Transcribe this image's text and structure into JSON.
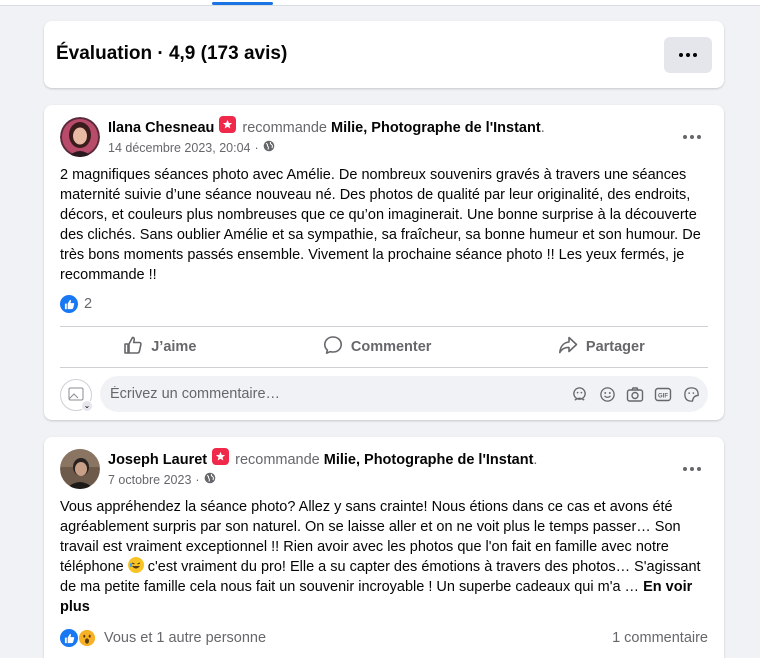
{
  "header": {
    "title": "Évaluation · 4,9 (173 avis)"
  },
  "posts": [
    {
      "author": "Ilana Chesneau",
      "recommends": "recommande",
      "page": "Milie, Photographe de l'Instant",
      "date": "14 décembre 2023, 20:04",
      "text": "2 magnifiques séances photo avec Amélie. De nombreux souvenirs gravés à travers une séances maternité suivie d’une séance nouveau né. Des photos de qualité par leur originalité, des endroits, décors, et couleurs plus nombreuses que ce qu’on imaginerait. Une bonne surprise à la découverte des clichés. Sans oublier Amélie et sa sympathie, sa fraîcheur, sa bonne humeur et son humour. De très bons moments passés ensemble. Vivement la prochaine séance photo !! Les yeux fermés, je recommande !!",
      "reaction_count": "2",
      "actions": {
        "like": "J’aime",
        "comment": "Commenter",
        "share": "Partager"
      },
      "comment_placeholder": "Écrivez un commentaire…"
    },
    {
      "author": "Joseph Lauret",
      "recommends": "recommande",
      "page": "Milie, Photographe de l'Instant",
      "date": "7 octobre 2023",
      "text_part1": "Vous appréhendez la séance photo? Allez y sans crainte! Nous étions dans ce cas et avons été agréablement surpris par son naturel. On se laisse aller et on ne voit plus le temps passer… Son travail est vraiment exceptionnel !! Rien avoir avec les photos que l'on fait en famille avec notre téléphone",
      "text_part2": "c'est vraiment du pro! Elle a su capter des émotions à travers des photos… S'agissant de ma petite famille cela nous fait un souvenir incroyable ! Un superbe cadeaux qui m'a …",
      "see_more": "En voir plus",
      "reaction_text": "Vous et 1 autre personne",
      "comment_count": "1 commentaire"
    }
  ],
  "icons": {
    "menu": "more-dots-icon",
    "recommend": "recommend-star-icon",
    "privacy": "globe-icon",
    "like": "thumbs-up-icon",
    "wow": "wow-emoji-icon",
    "comment": "speech-bubble-icon",
    "share": "share-arrow-icon"
  },
  "colors": {
    "accent": "#1877f2",
    "recommend_badge": "#f02849",
    "background": "#f0f2f5"
  }
}
